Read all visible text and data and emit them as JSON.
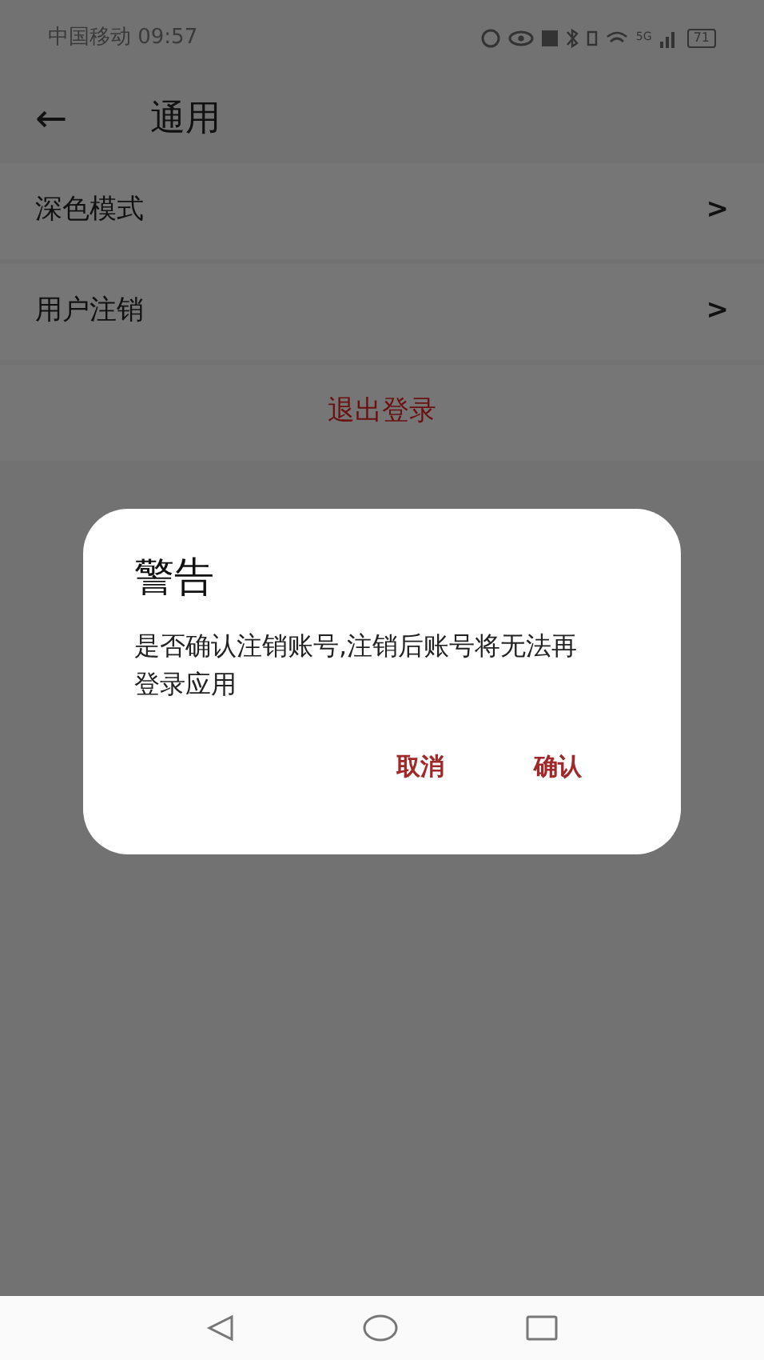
{
  "status_bar": {
    "carrier_time": "中国移动 09:57",
    "network": "5G",
    "battery": "71"
  },
  "header": {
    "back": "←",
    "title": "通用"
  },
  "settings": [
    {
      "label": "深色模式",
      "chevron": ">"
    },
    {
      "label": "用户注销",
      "chevron": ">"
    }
  ],
  "logout": "退出登录",
  "dialog": {
    "title": "警告",
    "message": "是否确认注销账号,注销后账号将无法再登录应用",
    "buttons": [
      "取消",
      "确认"
    ]
  }
}
